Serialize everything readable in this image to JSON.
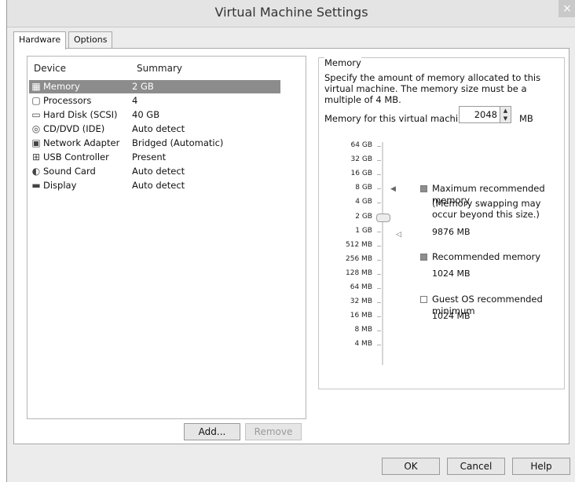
{
  "window": {
    "title": "Virtual Machine Settings",
    "close_glyph": "×"
  },
  "tabs": [
    {
      "label": "Hardware",
      "active": true
    },
    {
      "label": "Options",
      "active": false
    }
  ],
  "devices": {
    "headers": {
      "device": "Device",
      "summary": "Summary"
    },
    "rows": [
      {
        "name": "Memory",
        "summary": "2 GB",
        "icon": "memory-icon",
        "selected": true
      },
      {
        "name": "Processors",
        "summary": "4",
        "icon": "processor-icon"
      },
      {
        "name": "Hard Disk (SCSI)",
        "summary": "40 GB",
        "icon": "hard-disk-icon"
      },
      {
        "name": "CD/DVD (IDE)",
        "summary": "Auto detect",
        "icon": "cd-dvd-icon"
      },
      {
        "name": "Network Adapter",
        "summary": "Bridged (Automatic)",
        "icon": "network-adapter-icon"
      },
      {
        "name": "USB Controller",
        "summary": "Present",
        "icon": "usb-icon"
      },
      {
        "name": "Sound Card",
        "summary": "Auto detect",
        "icon": "speaker-icon"
      },
      {
        "name": "Display",
        "summary": "Auto detect",
        "icon": "monitor-icon"
      }
    ],
    "add_label": "Add...",
    "remove_label": "Remove"
  },
  "memory": {
    "group_title": "Memory",
    "description": "Specify the amount of memory allocated to this virtual machine. The memory size must be a multiple of 4 MB.",
    "field_label": "Memory for this virtual machine:",
    "value": "2048",
    "unit": "MB",
    "scale_labels": [
      "64 GB",
      "32 GB",
      "16 GB",
      "8 GB",
      "4 GB",
      "2 GB",
      "1 GB",
      "512 MB",
      "256 MB",
      "128 MB",
      "64 MB",
      "32 MB",
      "16 MB",
      "8 MB",
      "4 MB"
    ],
    "slider_level": "2 GB",
    "max_recommended": {
      "label": "Maximum recommended memory",
      "note_line1": "(Memory swapping may",
      "note_line2": "occur beyond this size.)",
      "value": "9876 MB"
    },
    "recommended": {
      "label": "Recommended memory",
      "value": "1024 MB"
    },
    "guest_min": {
      "label": "Guest OS recommended minimum",
      "value": "1024 MB"
    }
  },
  "footer": {
    "ok": "OK",
    "cancel": "Cancel",
    "help": "Help"
  }
}
